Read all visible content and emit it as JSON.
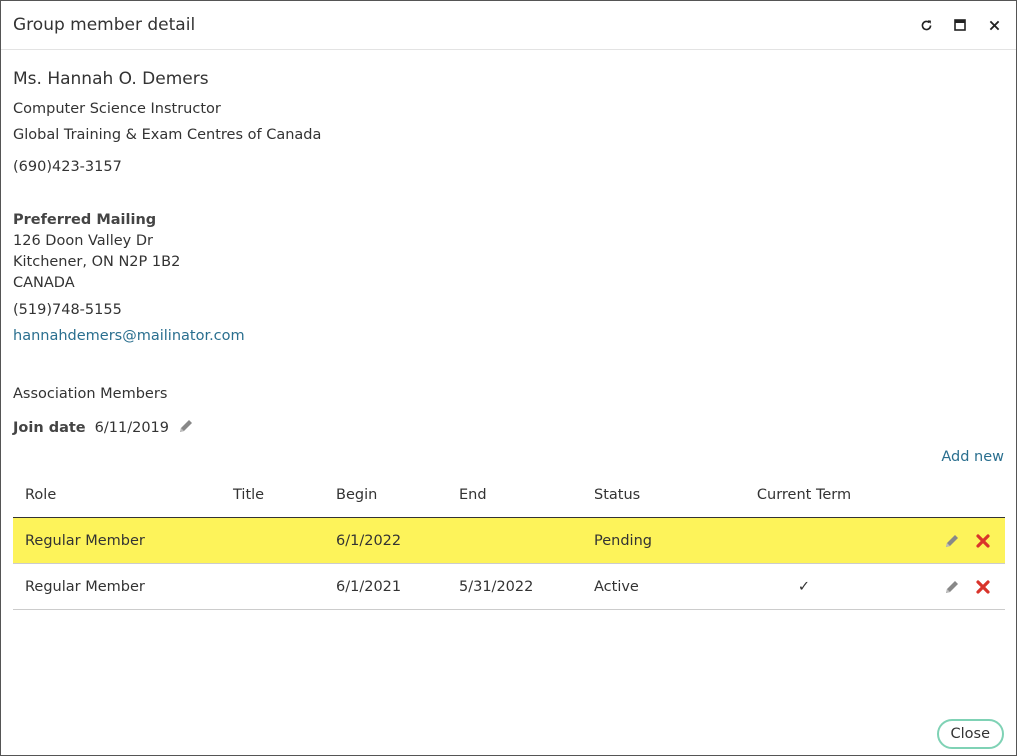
{
  "dialog": {
    "title": "Group member detail"
  },
  "member": {
    "name": "Ms. Hannah O. Demers",
    "job_title": "Computer Science Instructor",
    "organization": "Global Training & Exam Centres of Canada",
    "phone": "(690)423-3157"
  },
  "mailing": {
    "heading": "Preferred Mailing",
    "street": "126 Doon Valley Dr",
    "city_line": "Kitchener, ON N2P 1B2",
    "country": "CANADA",
    "phone": "(519)748-5155",
    "email": "hannahdemers@mailinator.com"
  },
  "association": {
    "heading": "Association Members",
    "join_label": "Join date",
    "join_value": "6/11/2019",
    "add_new_label": "Add new"
  },
  "table": {
    "headers": {
      "role": "Role",
      "title": "Title",
      "begin": "Begin",
      "end": "End",
      "status": "Status",
      "current_term": "Current Term"
    },
    "rows": [
      {
        "role": "Regular Member",
        "title": "",
        "begin": "6/1/2022",
        "end": "",
        "status": "Pending",
        "current_term": ""
      },
      {
        "role": "Regular Member",
        "title": "",
        "begin": "6/1/2021",
        "end": "5/31/2022",
        "status": "Active",
        "current_term": "✓"
      }
    ]
  },
  "footer": {
    "close_label": "Close"
  },
  "colors": {
    "link": "#2a6f8f",
    "highlight_row": "#fdf35a",
    "delete_icon": "#d9342b",
    "close_border": "#7fd2b5"
  },
  "icons": {
    "refresh": "refresh-icon",
    "maximize": "maximize-icon",
    "close": "close-icon",
    "edit": "pencil-icon",
    "delete": "delete-x-icon"
  }
}
